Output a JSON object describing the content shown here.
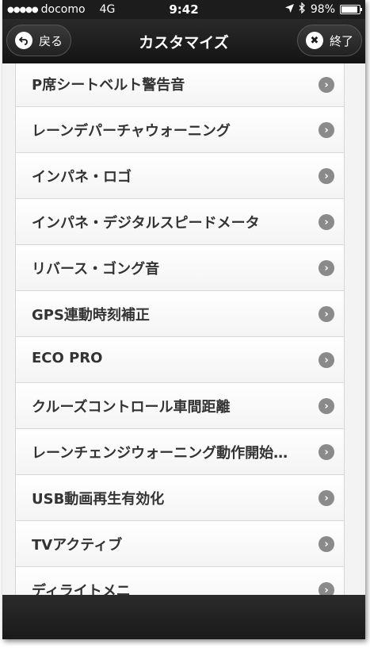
{
  "status": {
    "signal": "●●●●●",
    "carrier": "docomo",
    "network": "4G",
    "time": "9:42",
    "location_icon": "location-arrow-icon",
    "bluetooth_icon": "bluetooth-icon",
    "battery_percent": "98%",
    "battery_level": 0.98
  },
  "navbar": {
    "back_label": "戻る",
    "title": "カスタマイズ",
    "done_label": "終了"
  },
  "list": {
    "items": [
      {
        "label": "P席シートベルト警告音"
      },
      {
        "label": "レーンデパーチャウォーニング"
      },
      {
        "label": "インパネ・ロゴ"
      },
      {
        "label": "インパネ・デジタルスピードメータ"
      },
      {
        "label": "リバース・ゴング音"
      },
      {
        "label": "GPS連動時刻補正"
      },
      {
        "label": "ECO PRO"
      },
      {
        "label": "クルーズコントロール車間距離"
      },
      {
        "label": "レーンチェンジウォーニング動作開始…"
      },
      {
        "label": "USB動画再生有効化"
      },
      {
        "label": "TVアクティブ"
      },
      {
        "label": "ディライトメニ"
      }
    ]
  },
  "colors": {
    "bar_background": "#1c1c1c",
    "list_text": "#333333",
    "chevron": "#8a8a8a"
  }
}
